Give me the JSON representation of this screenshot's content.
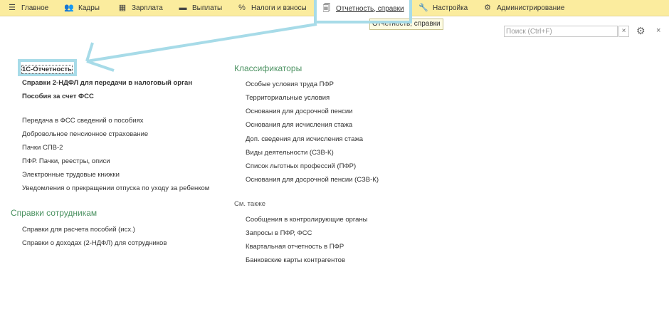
{
  "topbar": {
    "tabs": [
      {
        "label": "Главное",
        "icon": "menu-icon"
      },
      {
        "label": "Кадры",
        "icon": "people-icon"
      },
      {
        "label": "Зарплата",
        "icon": "calculator-icon"
      },
      {
        "label": "Выплаты",
        "icon": "wallet-icon"
      },
      {
        "label": "Налоги и взносы",
        "icon": "percent-icon"
      },
      {
        "label": "Отчетность, справки",
        "icon": "reports-icon",
        "active": true
      },
      {
        "label": "Настройка",
        "icon": "wrench-icon"
      },
      {
        "label": "Администрирование",
        "icon": "gear-icon"
      }
    ]
  },
  "tooltip": "Отчетность, справки",
  "search": {
    "placeholder": "Поиск (Ctrl+F)",
    "clear": "×"
  },
  "close": "×",
  "left": {
    "bold_items": [
      "1С-Отчетность",
      "Справки 2-НДФЛ для передачи в налоговый орган",
      "Пособия за счет ФСС"
    ],
    "items": [
      "Передача в ФСС сведений о пособиях",
      "Добровольное пенсионное страхование",
      "Пачки СПВ-2",
      "ПФР. Пачки, реестры, описи",
      "Электронные трудовые книжки",
      "Уведомления о прекращении отпуска по уходу за ребенком"
    ],
    "section_title": "Справки сотрудникам",
    "section_items": [
      "Справки для расчета пособий (исх.)",
      "Справки о доходах (2-НДФЛ) для сотрудников"
    ]
  },
  "right": {
    "section_title": "Классификаторы",
    "items": [
      "Особые условия труда ПФР",
      "Территориальные условия",
      "Основания для досрочной пенсии",
      "Основания для исчисления стажа",
      "Доп. сведения для исчисления стажа",
      "Виды деятельности (СЗВ-К)",
      "Список льготных профессий (ПФР)",
      "Основания для досрочной пенсии (СЗВ-К)"
    ],
    "see_also": "См. также",
    "see_also_items": [
      "Сообщения в контролирующие органы",
      "Запросы в ПФР, ФСС",
      "Квартальная отчетность в ПФР",
      "Банковские карты контрагентов"
    ]
  },
  "colors": {
    "topbar": "#fbec9e",
    "highlight": "#a7dbe8",
    "section": "#4a9160"
  }
}
